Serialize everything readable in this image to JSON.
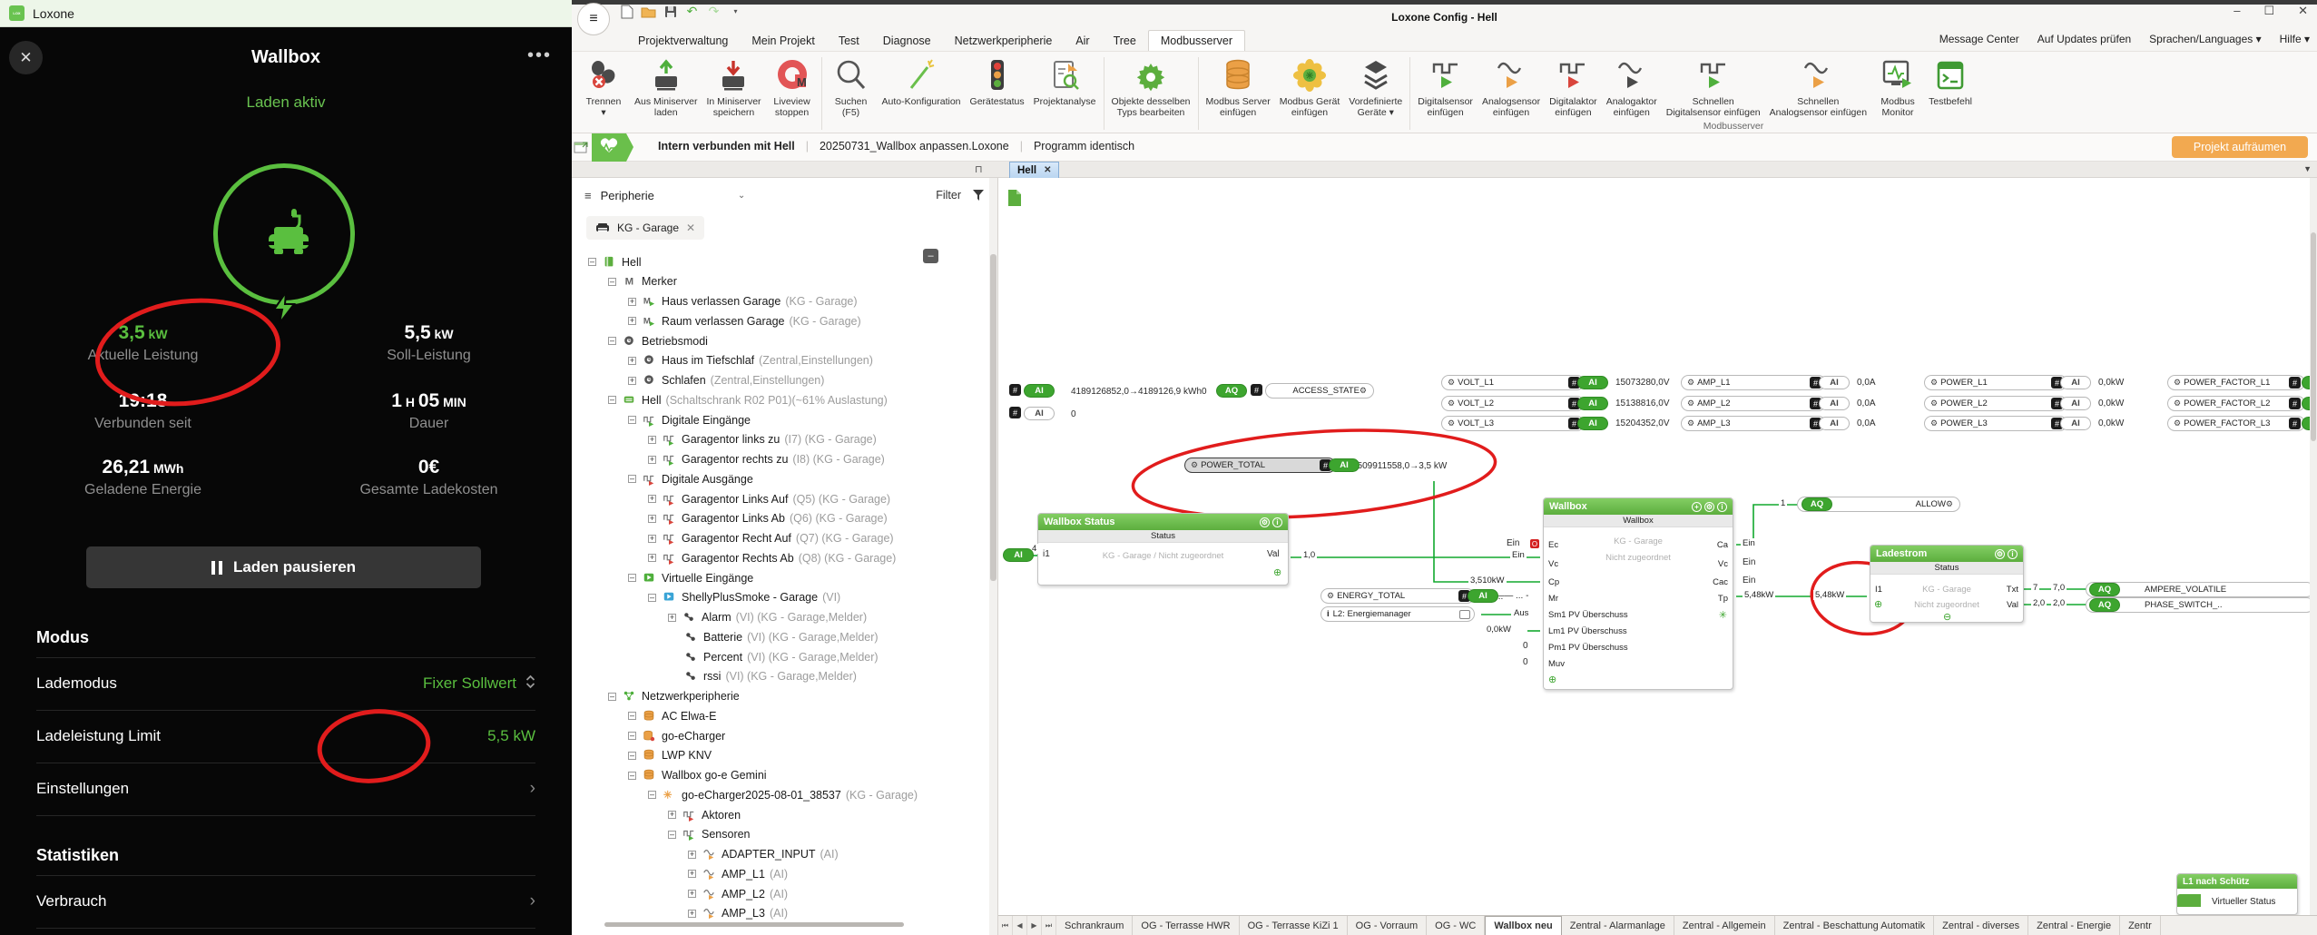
{
  "left_app": {
    "titlebar": {
      "title": "Loxone"
    },
    "header": {
      "title": "Wallbox"
    },
    "status_text": "Laden aktiv",
    "stats": [
      {
        "parts": [
          {
            "t": "3,5",
            "small": false
          },
          {
            "t": " kW",
            "small": true
          }
        ],
        "label": "Aktuelle Leistung",
        "green": true
      },
      {
        "parts": [
          {
            "t": "5,5",
            "small": false
          },
          {
            "t": " kW",
            "small": true
          }
        ],
        "label": "Soll-Leistung",
        "green": false
      },
      {
        "parts": [
          {
            "t": "19:18",
            "small": false
          }
        ],
        "label": "Verbunden seit",
        "green": false
      },
      {
        "parts": [
          {
            "t": "1",
            "small": false
          },
          {
            "t": " H ",
            "small": true
          },
          {
            "t": "05",
            "small": false
          },
          {
            "t": " MIN",
            "small": true
          }
        ],
        "label": "Dauer",
        "green": false
      },
      {
        "parts": [
          {
            "t": "26,21",
            "small": false
          },
          {
            "t": " MWh",
            "small": true
          }
        ],
        "label": "Geladene Energie",
        "green": false
      },
      {
        "parts": [
          {
            "t": "0€",
            "small": false
          }
        ],
        "label": "Gesamte Ladekosten",
        "green": false
      }
    ],
    "pause_button": "Laden pausieren",
    "sections": [
      {
        "heading": "Modus",
        "rows": [
          {
            "label": "Lademodus",
            "value": "Fixer Sollwert",
            "icon": "updown"
          },
          {
            "label": "Ladeleistung Limit",
            "value": "5,5 kW",
            "icon": ""
          },
          {
            "label": "Einstellungen",
            "value": "",
            "icon": "chevron"
          }
        ]
      },
      {
        "heading": "Statistiken",
        "rows": [
          {
            "label": "Verbrauch",
            "value": "",
            "icon": "chevron"
          }
        ]
      }
    ]
  },
  "config": {
    "window": {
      "title": "Loxone Config - Hell",
      "min": "–",
      "max": "☐",
      "close": "✕"
    },
    "menu": {
      "items": [
        "Projektverwaltung",
        "Mein Projekt",
        "Test",
        "Diagnose",
        "Netzwerkperipherie",
        "Air",
        "Tree",
        "Modbusserver"
      ],
      "active": "Modbusserver",
      "right": [
        "Message Center",
        "Auf Updates prüfen",
        "Sprachen/Languages",
        "Hilfe"
      ]
    },
    "ribbon": {
      "groups": [
        [
          {
            "icon": "trennen",
            "label": "Trennen\n▾"
          },
          {
            "icon": "loadup",
            "label": "Aus Miniserver\nladen"
          },
          {
            "icon": "savedown",
            "label": "In Miniserver\nspeichern"
          },
          {
            "icon": "liveview",
            "label": "Liveview\nstoppen"
          }
        ],
        [
          {
            "icon": "search",
            "label": "Suchen\n(F5)"
          },
          {
            "icon": "wand",
            "label": "Auto-Konfiguration"
          },
          {
            "icon": "traffic",
            "label": "Gerätestatus"
          },
          {
            "icon": "analyse",
            "label": "Projektanalyse"
          }
        ],
        [
          {
            "icon": "gear",
            "label": "Objekte desselben\nTyps bearbeiten"
          }
        ],
        [
          {
            "icon": "db",
            "label": "Modbus Server\neinfügen"
          },
          {
            "icon": "flower",
            "label": "Modbus Gerät\neinfügen"
          },
          {
            "icon": "layers",
            "label": "Vordefinierte\nGeräte ▾"
          }
        ],
        [
          {
            "icon": "sq-green",
            "label": "Digitalsensor\neinfügen"
          },
          {
            "icon": "sine-orange",
            "label": "Analogsensor\neinfügen"
          },
          {
            "icon": "sq-red",
            "label": "Digitalaktor\neinfügen"
          },
          {
            "icon": "sine-dark",
            "label": "Analogaktor\neinfügen"
          },
          {
            "icon": "sq-green",
            "label": "Schnellen\nDigitalsensor einfügen"
          },
          {
            "icon": "sine-orange",
            "label": "Schnellen\nAnalogsensor einfügen"
          },
          {
            "icon": "monitor",
            "label": "Modbus\nMonitor"
          },
          {
            "icon": "test",
            "label": "Testbefehl"
          }
        ]
      ],
      "group_label": "Modbusserver"
    },
    "statusbar": {
      "connection": "Intern verbunden mit Hell",
      "file": "20250731_Wallbox anpassen.Loxone",
      "state": "Programm identisch",
      "action": "Projekt aufräumen"
    },
    "doc_tab": {
      "label": "Hell",
      "close": "✕"
    },
    "tree": {
      "header": {
        "title": "Peripherie",
        "filter": "Filter"
      },
      "chip": "KG - Garage",
      "items": [
        {
          "l": 0,
          "e": "-",
          "i": "project",
          "n": "Hell",
          "t": ""
        },
        {
          "l": 1,
          "e": "-",
          "i": "marker",
          "n": "Merker",
          "t": ""
        },
        {
          "l": 2,
          "e": "+",
          "i": "marker-play",
          "n": "Haus verlassen Garage",
          "t": "(KG - Garage)"
        },
        {
          "l": 2,
          "e": "+",
          "i": "marker-play",
          "n": "Raum verlassen Garage",
          "t": "(KG - Garage)"
        },
        {
          "l": 1,
          "e": "-",
          "i": "opmode",
          "n": "Betriebsmodi",
          "t": ""
        },
        {
          "l": 2,
          "e": "+",
          "i": "opmode",
          "n": "Haus im Tiefschlaf",
          "t": "(Zentral,Einstellungen)"
        },
        {
          "l": 2,
          "e": "+",
          "i": "opmode",
          "n": "Schlafen",
          "t": "(Zentral,Einstellungen)"
        },
        {
          "l": 1,
          "e": "-",
          "i": "miniserver",
          "n": "Hell",
          "t": "(Schaltschrank R02 P01)(~61% Auslastung)"
        },
        {
          "l": 2,
          "e": "-",
          "i": "din",
          "n": "Digitale Eingänge",
          "t": ""
        },
        {
          "l": 3,
          "e": "+",
          "i": "din",
          "n": "Garagentor links zu",
          "t": "(I7) (KG - Garage)"
        },
        {
          "l": 3,
          "e": "+",
          "i": "din",
          "n": "Garagentor rechts zu",
          "t": "(I8) (KG - Garage)"
        },
        {
          "l": 2,
          "e": "-",
          "i": "dout",
          "n": "Digitale Ausgänge",
          "t": ""
        },
        {
          "l": 3,
          "e": "+",
          "i": "dout",
          "n": "Garagentor Links Auf",
          "t": "(Q5) (KG - Garage)"
        },
        {
          "l": 3,
          "e": "+",
          "i": "dout",
          "n": "Garagentor Links Ab",
          "t": "(Q6) (KG - Garage)"
        },
        {
          "l": 3,
          "e": "+",
          "i": "dout",
          "n": "Garagentor Recht Auf",
          "t": "(Q7) (KG - Garage)"
        },
        {
          "l": 3,
          "e": "+",
          "i": "dout",
          "n": "Garagentor Rechts Ab",
          "t": "(Q8) (KG - Garage)"
        },
        {
          "l": 2,
          "e": "-",
          "i": "vin",
          "n": "Virtuelle Eingänge",
          "t": ""
        },
        {
          "l": 3,
          "e": "-",
          "i": "vin-blue",
          "n": "ShellyPlusSmoke - Garage",
          "t": "(VI)"
        },
        {
          "l": 4,
          "e": "+",
          "i": "conn",
          "n": "Alarm",
          "t": "(VI) (KG - Garage,Melder)"
        },
        {
          "l": 4,
          "e": "",
          "i": "conn",
          "n": "Batterie",
          "t": "(VI) (KG - Garage,Melder)"
        },
        {
          "l": 4,
          "e": "",
          "i": "conn",
          "n": "Percent",
          "t": "(VI) (KG - Garage,Melder)"
        },
        {
          "l": 4,
          "e": "",
          "i": "conn",
          "n": "rssi",
          "t": "(VI) (KG - Garage,Melder)"
        },
        {
          "l": 1,
          "e": "-",
          "i": "network",
          "n": "Netzwerkperipherie",
          "t": ""
        },
        {
          "l": 2,
          "e": "-",
          "i": "db",
          "n": "AC Elwa-E",
          "t": ""
        },
        {
          "l": 2,
          "e": "-",
          "i": "db-red",
          "n": "go-eCharger",
          "t": ""
        },
        {
          "l": 2,
          "e": "-",
          "i": "db",
          "n": "LWP KNV",
          "t": ""
        },
        {
          "l": 2,
          "e": "-",
          "i": "db",
          "n": "Wallbox go-e Gemini",
          "t": ""
        },
        {
          "l": 3,
          "e": "-",
          "i": "flower",
          "n": "go-eCharger2025-08-01_38537",
          "t": "(KG - Garage)"
        },
        {
          "l": 4,
          "e": "+",
          "i": "dout",
          "n": "Aktoren",
          "t": ""
        },
        {
          "l": 4,
          "e": "-",
          "i": "din",
          "n": "Sensoren",
          "t": ""
        },
        {
          "l": 5,
          "e": "+",
          "i": "ain",
          "n": "ADAPTER_INPUT",
          "t": "(AI)"
        },
        {
          "l": 5,
          "e": "+",
          "i": "ain",
          "n": "AMP_L1",
          "t": "(AI)"
        },
        {
          "l": 5,
          "e": "+",
          "i": "ain",
          "n": "AMP_L2",
          "t": "(AI)"
        },
        {
          "l": 5,
          "e": "+",
          "i": "ain",
          "n": "AMP_L3",
          "t": "(AI)"
        }
      ]
    },
    "canvas": {
      "ai_row1": {
        "pill": "AI",
        "value": "4189126852,0→4189126,9 kWh",
        "aux": "0"
      },
      "ai_row2": {
        "pill": "AI",
        "value": "0"
      },
      "access_state": {
        "pill": "AQ",
        "label": "ACCESS_STATE"
      },
      "volt": {
        "labels": [
          "VOLT_L1",
          "VOLT_L2",
          "VOLT_L3"
        ],
        "values": [
          "15073280,0V",
          "15138816,0V",
          "15204352,0V"
        ]
      },
      "amp": {
        "labels": [
          "AMP_L1",
          "AMP_L2",
          "AMP_L3"
        ],
        "values": [
          "0,0A",
          "0,0A",
          "0,0A"
        ]
      },
      "power": {
        "labels": [
          "POWER_L1",
          "POWER_L2",
          "POWER_L3"
        ],
        "values": [
          "0,0kW",
          "0,0kW",
          "0,0kW"
        ]
      },
      "pf": {
        "labels": [
          "POWER_FACTOR_L1",
          "POWER_FACTOR_L2",
          "POWER_FACTOR_L3"
        ]
      },
      "power_total": {
        "label": "POWER_TOTAL",
        "pill": "AI",
        "value": "3509911558,0→3,5 kW"
      },
      "energy_total": {
        "label": "ENERGY_TOTAL",
        "pill": "AI",
        "trail": "- ... —— ... -"
      },
      "l2": {
        "label": "L2: Energiemanager",
        "out": "Aus"
      },
      "wallbox_status": {
        "title": "Wallbox Status",
        "band": "Status",
        "port_in": "i1",
        "note": "KG - Garage / Nicht zugeordnet",
        "port_out": "Val",
        "in_pill": "AI",
        "in_label": "4",
        "out_label": "1,0",
        "out_value": "Ein"
      },
      "cp_label": "3,510kW",
      "wallbox": {
        "title": "Wallbox",
        "band": "Wallbox",
        "place": "KG - Garage",
        "assign": "Nicht zugeordnet",
        "left": [
          {
            "p": "Ec",
            "v": "Ein"
          },
          {
            "p": "Vc",
            "v": "Ein"
          },
          {
            "p": "Cp",
            "v": "3,510kW"
          },
          {
            "p": "Mr",
            "v": "..."
          },
          {
            "p": "Sm1 PV Überschuss",
            "v": "Aus"
          },
          {
            "p": "Lm1 PV Überschuss",
            "v": "0,0kW"
          },
          {
            "p": "Pm1 PV Überschuss",
            "v": "0"
          },
          {
            "p": "Muv",
            "v": "0"
          }
        ],
        "right": [
          {
            "p": "Ca",
            "v": "Ein"
          },
          {
            "p": "Vc",
            "v": "Ein"
          },
          {
            "p": "Cac",
            "v": "Ein"
          },
          {
            "p": "Tp",
            "v": "5,48kW"
          }
        ]
      },
      "allow": {
        "pill": "AQ",
        "label": "ALLOW",
        "in": "1"
      },
      "tp_wire": {
        "v1": "5,48kW",
        "v2": "5,48kW"
      },
      "ladestrom": {
        "title": "Ladestrom",
        "band": "Status",
        "port_in": "I1",
        "place": "KG - Garage",
        "assign": "Nicht zugeordnet",
        "outs": [
          {
            "p": "Txt",
            "w1": "7",
            "w2": "7,0",
            "pill": "AQ",
            "target": "AMPERE_VOLATILE"
          },
          {
            "p": "Val",
            "w1": "2,0",
            "w2": "2,0",
            "pill": "AQ",
            "target": "PHASE_SWITCH_.."
          }
        ]
      },
      "l1_block": {
        "title": "L1 nach Schütz",
        "note": "Virtueller Status"
      }
    },
    "page_tabs": {
      "items": [
        "Schrankraum",
        "OG - Terrasse HWR",
        "OG - Terrasse KiZi 1",
        "OG - Vorraum",
        "OG - WC",
        "Wallbox neu",
        "Zentral - Alarmanlage",
        "Zentral - Allgemein",
        "Zentral - Beschattung Automatik",
        "Zentral - diverses",
        "Zentral - Energie",
        "Zentr"
      ],
      "active": "Wallbox neu"
    }
  }
}
